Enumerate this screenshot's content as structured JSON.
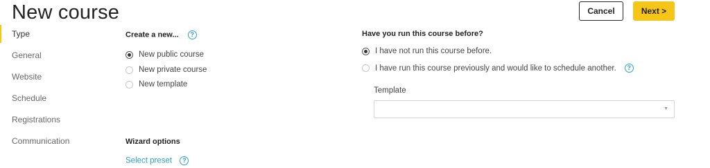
{
  "header": {
    "title": "New course",
    "cancel_label": "Cancel",
    "next_label": "Next >"
  },
  "sidebar": {
    "items": [
      {
        "label": "Type"
      },
      {
        "label": "General"
      },
      {
        "label": "Website"
      },
      {
        "label": "Schedule"
      },
      {
        "label": "Registrations"
      },
      {
        "label": "Communication"
      }
    ]
  },
  "create": {
    "heading": "Create a new...",
    "options": [
      {
        "label": "New public course",
        "checked": true
      },
      {
        "label": "New private course",
        "checked": false
      },
      {
        "label": "New template",
        "checked": false
      }
    ]
  },
  "history": {
    "heading": "Have you run this course before?",
    "options": [
      {
        "label": "I have not run this course before.",
        "checked": true
      },
      {
        "label": "I have run this course previously and would like to schedule another.",
        "checked": false
      }
    ],
    "template_label": "Template",
    "template_value": ""
  },
  "wizard": {
    "heading": "Wizard options",
    "preset_link": "Select preset"
  },
  "icons": {
    "help": "help-circle-icon",
    "caret": "caret-down-icon"
  },
  "colors": {
    "accent": "#f5c518",
    "link": "#2a9fd6",
    "text": "#333333"
  }
}
